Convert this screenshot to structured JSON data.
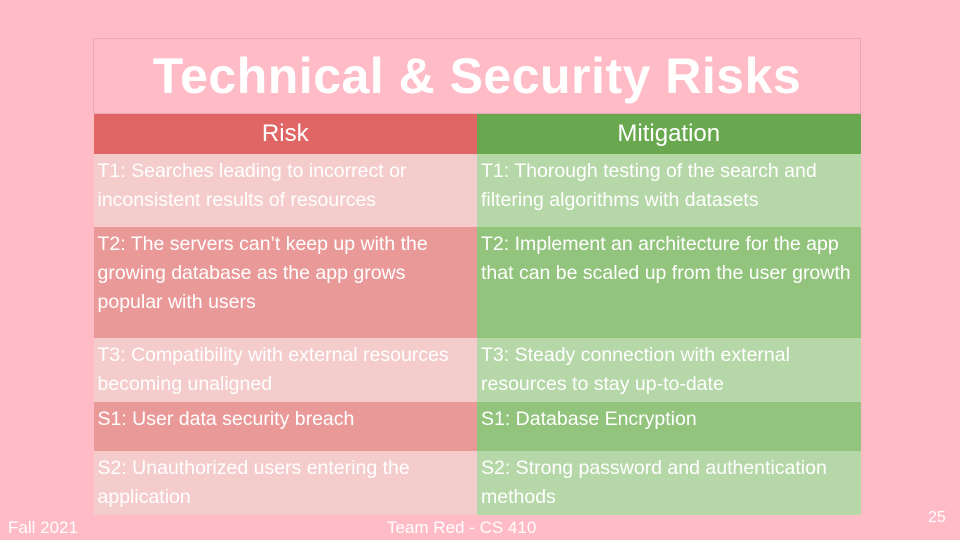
{
  "slide": {
    "title": "Technical & Security Risks",
    "headers": {
      "risk": "Risk",
      "mitigation": "Mitigation"
    },
    "rows": [
      {
        "risk": "T1: Searches leading to incorrect or inconsistent results of resources",
        "mitigation": "T1: Thorough testing of the search and filtering algorithms with datasets"
      },
      {
        "risk": "T2: The servers can’t keep up with the growing database as the app grows popular with users",
        "mitigation": "T2: Implement an architecture for the app that can be scaled up from the user growth"
      },
      {
        "risk": "T3: Compatibility with external resources becoming unaligned",
        "mitigation": "T3: Steady connection with external resources to stay up-to-date"
      },
      {
        "risk": "S1: User data security breach",
        "mitigation": "S1: Database Encryption"
      },
      {
        "risk": "S2: Unauthorized users entering the application",
        "mitigation": "S2: Strong password and authentication methods"
      }
    ]
  },
  "footer": {
    "left": "Fall 2021",
    "center": "Team Red - CS 410",
    "page_number": "25"
  },
  "colors": {
    "background": "#ffbbc6",
    "risk_header": "#e06666",
    "mitigation_header": "#6aa84f",
    "risk_light": "#f4cccc",
    "risk_dark": "#ea9999",
    "mitigation_light": "#b6d7a8",
    "mitigation_dark": "#93c47d"
  }
}
